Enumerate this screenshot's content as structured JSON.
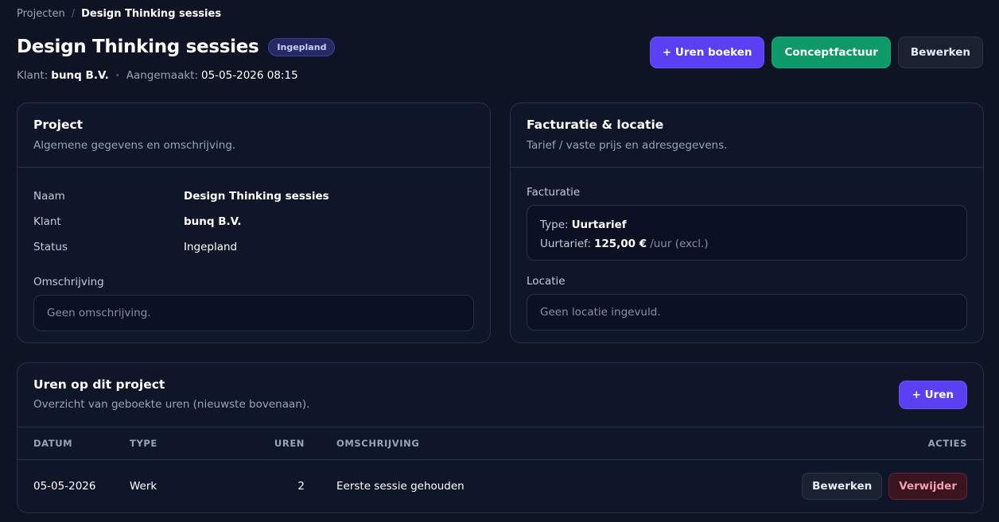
{
  "breadcrumb": {
    "parent": "Projecten",
    "separator": "/",
    "current": "Design Thinking sessies"
  },
  "header": {
    "title": "Design Thinking sessies",
    "status": "Ingepland",
    "client_label": "Klant:",
    "client": "bunq B.V.",
    "created_label": "Aangemaakt:",
    "created": "05-05-2026 08:15",
    "actions": {
      "book_hours": "+ Uren boeken",
      "draft_invoice": "Conceptfactuur",
      "edit": "Bewerken"
    }
  },
  "project_card": {
    "title": "Project",
    "subtitle": "Algemene gegevens en omschrijving.",
    "fields": [
      {
        "key": "Naam",
        "value": "Design Thinking sessies"
      },
      {
        "key": "Klant",
        "value": "bunq B.V."
      },
      {
        "key": "Status",
        "value": "Ingepland"
      }
    ],
    "description_label": "Omschrijving",
    "description": "Geen omschrijving."
  },
  "billing_card": {
    "title": "Facturatie & locatie",
    "subtitle": "Tarief / vaste prijs en adresgegevens.",
    "billing_label": "Facturatie",
    "type_label": "Type:",
    "type_value": "Uurtarief",
    "rate_label": "Uurtarief:",
    "rate_value": "125,00 €",
    "rate_suffix": "/uur (excl.)",
    "location_label": "Locatie",
    "location": "Geen locatie ingevuld."
  },
  "hours_card": {
    "title": "Uren op dit project",
    "subtitle": "Overzicht van geboekte uren (nieuwste bovenaan).",
    "add_button": "+ Uren",
    "columns": {
      "date": "DATUM",
      "type": "TYPE",
      "hours": "UREN",
      "description": "OMSCHRIJVING",
      "actions": "ACTIES"
    },
    "rows": [
      {
        "date": "05-05-2026",
        "type": "Werk",
        "hours": "2",
        "description": "Eerste sessie gehouden",
        "edit": "Bewerken",
        "delete": "Verwijder"
      }
    ]
  },
  "colors": {
    "accent": "#5b3ff2",
    "success": "#0f9868",
    "danger": "#3a1420",
    "background": "#0e1424"
  }
}
